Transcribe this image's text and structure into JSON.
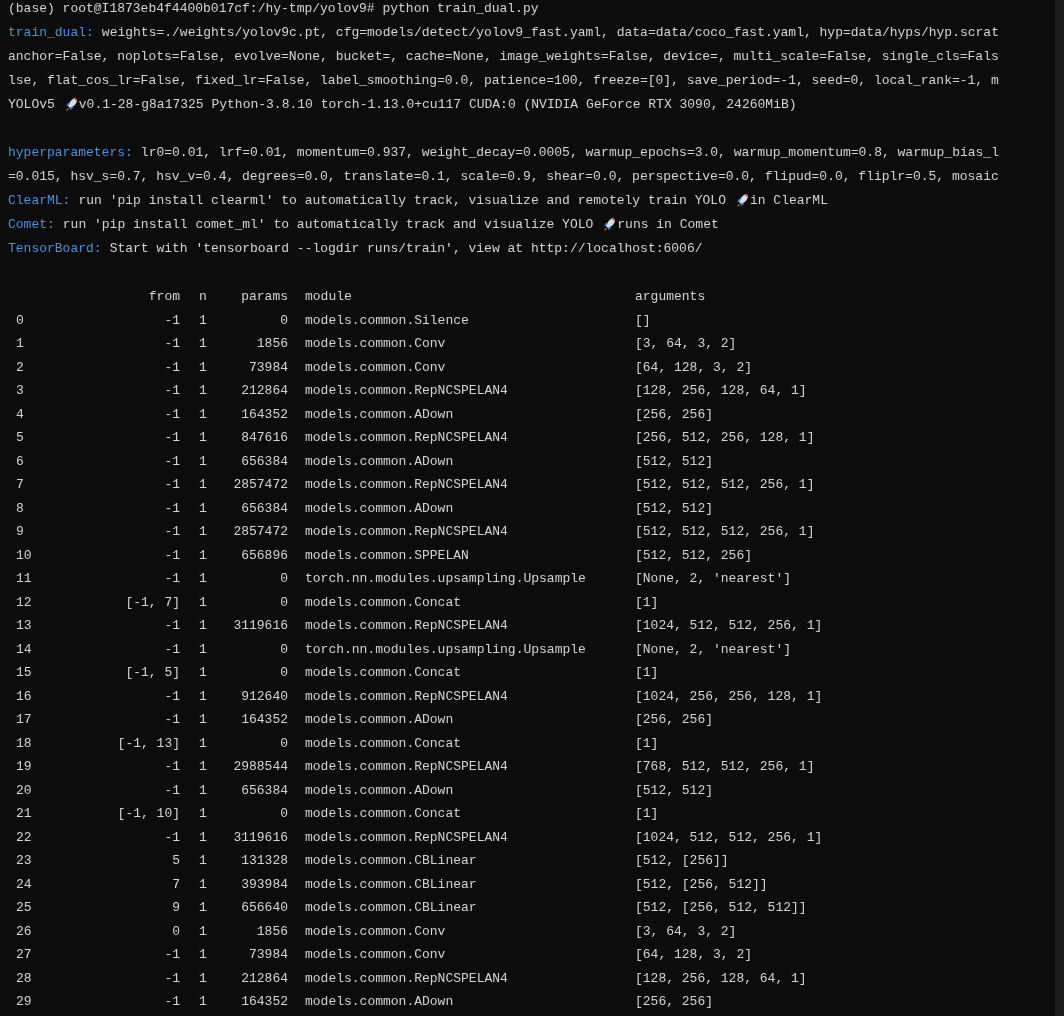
{
  "terminal": {
    "blocks": [
      {
        "lines": [
          {
            "segments": [
              {
                "kind": "text",
                "text": "(base) root@I1873eb4f4400b017cf:/hy-tmp/yolov9# python train_dual.py"
              }
            ]
          },
          {
            "segments": [
              {
                "kind": "label",
                "text": "train_dual:"
              },
              {
                "kind": "text",
                "text": "weights=./weights/yolov9c.pt, cfg=models/detect/yolov9_fast.yaml, data=data/coco_fast.yaml, hyp=data/hyps/hyp.scrat"
              }
            ]
          },
          {
            "segments": [
              {
                "kind": "text",
                "text": "anchor=False, noplots=False, evolve=None, bucket=, cache=None, image_weights=False, device=, multi_scale=False, single_cls=Fals"
              }
            ]
          },
          {
            "segments": [
              {
                "kind": "text",
                "text": "lse, flat_cos_lr=False, fixed_lr=False, label_smoothing=0.0, patience=100, freeze=[0], save_period=-1, seed=0, local_rank=-1, m"
              }
            ]
          },
          {
            "segments": [
              {
                "kind": "text",
                "text": "YOLOv5"
              },
              {
                "kind": "rocket"
              },
              {
                "kind": "text",
                "text": "v0.1-28-g8a17325 Python-3.8.10 torch-1.13.0+cu117 CUDA:0 (NVIDIA GeForce RTX 3090, 24260MiB)"
              }
            ]
          }
        ]
      },
      {
        "lines": [
          {
            "segments": [
              {
                "kind": "label",
                "text": "hyperparameters:"
              },
              {
                "kind": "text",
                "text": "lr0=0.01, lrf=0.01, momentum=0.937, weight_decay=0.0005, warmup_epochs=3.0, warmup_momentum=0.8, warmup_bias_l"
              }
            ]
          },
          {
            "segments": [
              {
                "kind": "text",
                "text": "=0.015, hsv_s=0.7, hsv_v=0.4, degrees=0.0, translate=0.1, scale=0.9, shear=0.0, perspective=0.0, flipud=0.0, fliplr=0.5, mosaic"
              }
            ]
          },
          {
            "segments": [
              {
                "kind": "label",
                "text": "ClearML:"
              },
              {
                "kind": "text",
                "text": "run 'pip install clearml' to automatically track, visualize and remotely train YOLO"
              },
              {
                "kind": "rocket"
              },
              {
                "kind": "text",
                "text": "in ClearML"
              }
            ]
          },
          {
            "segments": [
              {
                "kind": "label",
                "text": "Comet:"
              },
              {
                "kind": "text",
                "text": "run 'pip install comet_ml' to automatically track and visualize YOLO"
              },
              {
                "kind": "rocket"
              },
              {
                "kind": "text",
                "text": "runs in Comet"
              }
            ]
          },
          {
            "segments": [
              {
                "kind": "label",
                "text": "TensorBoard:"
              },
              {
                "kind": "text",
                "text": "Start with 'tensorboard --logdir runs/train', view at http://localhost:6006/"
              }
            ]
          }
        ]
      }
    ],
    "layer_table": {
      "columns": [
        "from",
        "n",
        "params",
        "module",
        "arguments"
      ],
      "rows": [
        {
          "index": "0",
          "from": "-1",
          "n": "1",
          "params": "0",
          "module": "models.common.Silence",
          "arguments": "[]"
        },
        {
          "index": "1",
          "from": "-1",
          "n": "1",
          "params": "1856",
          "module": "models.common.Conv",
          "arguments": "[3, 64, 3, 2]"
        },
        {
          "index": "2",
          "from": "-1",
          "n": "1",
          "params": "73984",
          "module": "models.common.Conv",
          "arguments": "[64, 128, 3, 2]"
        },
        {
          "index": "3",
          "from": "-1",
          "n": "1",
          "params": "212864",
          "module": "models.common.RepNCSPELAN4",
          "arguments": "[128, 256, 128, 64, 1]"
        },
        {
          "index": "4",
          "from": "-1",
          "n": "1",
          "params": "164352",
          "module": "models.common.ADown",
          "arguments": "[256, 256]"
        },
        {
          "index": "5",
          "from": "-1",
          "n": "1",
          "params": "847616",
          "module": "models.common.RepNCSPELAN4",
          "arguments": "[256, 512, 256, 128, 1]"
        },
        {
          "index": "6",
          "from": "-1",
          "n": "1",
          "params": "656384",
          "module": "models.common.ADown",
          "arguments": "[512, 512]"
        },
        {
          "index": "7",
          "from": "-1",
          "n": "1",
          "params": "2857472",
          "module": "models.common.RepNCSPELAN4",
          "arguments": "[512, 512, 512, 256, 1]"
        },
        {
          "index": "8",
          "from": "-1",
          "n": "1",
          "params": "656384",
          "module": "models.common.ADown",
          "arguments": "[512, 512]"
        },
        {
          "index": "9",
          "from": "-1",
          "n": "1",
          "params": "2857472",
          "module": "models.common.RepNCSPELAN4",
          "arguments": "[512, 512, 512, 256, 1]"
        },
        {
          "index": "10",
          "from": "-1",
          "n": "1",
          "params": "656896",
          "module": "models.common.SPPELAN",
          "arguments": "[512, 512, 256]"
        },
        {
          "index": "11",
          "from": "-1",
          "n": "1",
          "params": "0",
          "module": "torch.nn.modules.upsampling.Upsample",
          "arguments": "[None, 2, 'nearest']"
        },
        {
          "index": "12",
          "from": "[-1, 7]",
          "n": "1",
          "params": "0",
          "module": "models.common.Concat",
          "arguments": "[1]"
        },
        {
          "index": "13",
          "from": "-1",
          "n": "1",
          "params": "3119616",
          "module": "models.common.RepNCSPELAN4",
          "arguments": "[1024, 512, 512, 256, 1]"
        },
        {
          "index": "14",
          "from": "-1",
          "n": "1",
          "params": "0",
          "module": "torch.nn.modules.upsampling.Upsample",
          "arguments": "[None, 2, 'nearest']"
        },
        {
          "index": "15",
          "from": "[-1, 5]",
          "n": "1",
          "params": "0",
          "module": "models.common.Concat",
          "arguments": "[1]"
        },
        {
          "index": "16",
          "from": "-1",
          "n": "1",
          "params": "912640",
          "module": "models.common.RepNCSPELAN4",
          "arguments": "[1024, 256, 256, 128, 1]"
        },
        {
          "index": "17",
          "from": "-1",
          "n": "1",
          "params": "164352",
          "module": "models.common.ADown",
          "arguments": "[256, 256]"
        },
        {
          "index": "18",
          "from": "[-1, 13]",
          "n": "1",
          "params": "0",
          "module": "models.common.Concat",
          "arguments": "[1]"
        },
        {
          "index": "19",
          "from": "-1",
          "n": "1",
          "params": "2988544",
          "module": "models.common.RepNCSPELAN4",
          "arguments": "[768, 512, 512, 256, 1]"
        },
        {
          "index": "20",
          "from": "-1",
          "n": "1",
          "params": "656384",
          "module": "models.common.ADown",
          "arguments": "[512, 512]"
        },
        {
          "index": "21",
          "from": "[-1, 10]",
          "n": "1",
          "params": "0",
          "module": "models.common.Concat",
          "arguments": "[1]"
        },
        {
          "index": "22",
          "from": "-1",
          "n": "1",
          "params": "3119616",
          "module": "models.common.RepNCSPELAN4",
          "arguments": "[1024, 512, 512, 256, 1]"
        },
        {
          "index": "23",
          "from": "5",
          "n": "1",
          "params": "131328",
          "module": "models.common.CBLinear",
          "arguments": "[512, [256]]"
        },
        {
          "index": "24",
          "from": "7",
          "n": "1",
          "params": "393984",
          "module": "models.common.CBLinear",
          "arguments": "[512, [256, 512]]"
        },
        {
          "index": "25",
          "from": "9",
          "n": "1",
          "params": "656640",
          "module": "models.common.CBLinear",
          "arguments": "[512, [256, 512, 512]]"
        },
        {
          "index": "26",
          "from": "0",
          "n": "1",
          "params": "1856",
          "module": "models.common.Conv",
          "arguments": "[3, 64, 3, 2]"
        },
        {
          "index": "27",
          "from": "-1",
          "n": "1",
          "params": "73984",
          "module": "models.common.Conv",
          "arguments": "[64, 128, 3, 2]"
        },
        {
          "index": "28",
          "from": "-1",
          "n": "1",
          "params": "212864",
          "module": "models.common.RepNCSPELAN4",
          "arguments": "[128, 256, 128, 64, 1]"
        },
        {
          "index": "29",
          "from": "-1",
          "n": "1",
          "params": "164352",
          "module": "models.common.ADown",
          "arguments": "[256, 256]"
        }
      ]
    }
  }
}
